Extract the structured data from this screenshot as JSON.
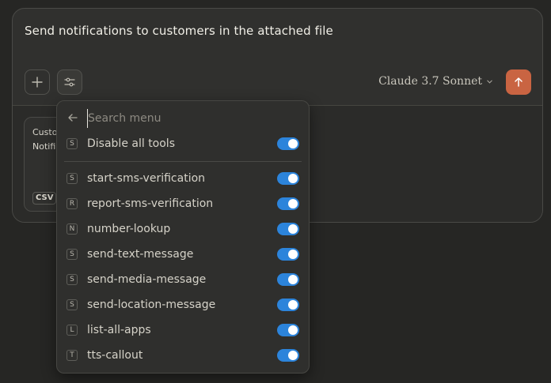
{
  "composer": {
    "prompt_text": "Send notifications to customers in the attached file",
    "model_name": "Claude 3.7 Sonnet",
    "accent_color": "#c96442"
  },
  "attachment": {
    "line1": "Custo",
    "line2": "Notifi",
    "badge": "CSV"
  },
  "tools_menu": {
    "search_placeholder": "Search menu",
    "disable_all": {
      "badge": "S",
      "label": "Disable all tools",
      "enabled": true
    },
    "items": [
      {
        "badge": "S",
        "label": "start-sms-verification",
        "enabled": true
      },
      {
        "badge": "R",
        "label": "report-sms-verification",
        "enabled": true
      },
      {
        "badge": "N",
        "label": "number-lookup",
        "enabled": true
      },
      {
        "badge": "S",
        "label": "send-text-message",
        "enabled": true
      },
      {
        "badge": "S",
        "label": "send-media-message",
        "enabled": true
      },
      {
        "badge": "S",
        "label": "send-location-message",
        "enabled": true
      },
      {
        "badge": "L",
        "label": "list-all-apps",
        "enabled": true
      },
      {
        "badge": "T",
        "label": "tts-callout",
        "enabled": true
      }
    ],
    "toggle_color": "#2c84db"
  }
}
